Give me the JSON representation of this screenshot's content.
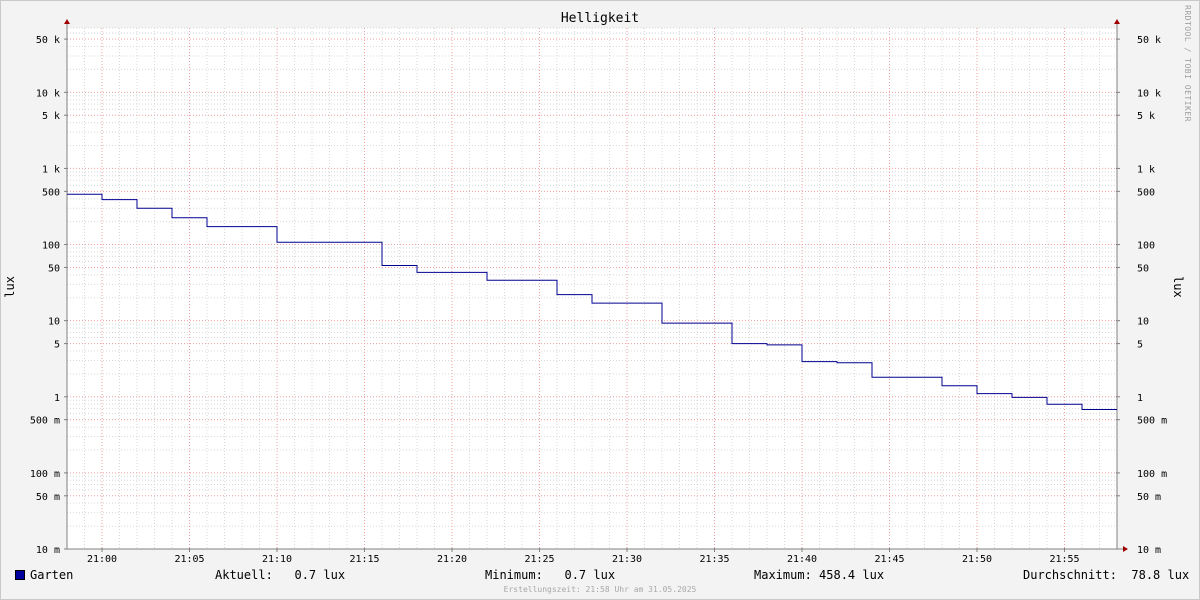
{
  "title": "Helligkeit",
  "vendor": "RRDTOOL / TOBI OETIKER",
  "ylabel": "lux",
  "colors": {
    "plot_bg": "#ffffff",
    "line": "#000090",
    "swatch": "#0000a0",
    "major_grid": "#f0a0a0",
    "minor_grid": "#d8d8d8",
    "axis": "#808080",
    "arrow": "#a00000"
  },
  "legend": {
    "series": "Garten",
    "current": "Aktuell:   0.7 lux",
    "minimum": "Minimum:   0.7 lux",
    "maximum": "Maximum: 458.4 lux",
    "average": "Durchschnitt:  78.8 lux"
  },
  "footer": "Erstellungszeit: 21:58 Uhr am 31.05.2025",
  "chart_data": {
    "type": "line",
    "title": "Helligkeit",
    "ylabel": "lux",
    "yscale": "log",
    "ylim": [
      0.01,
      70000
    ],
    "xlim": [
      "20:58",
      "21:58"
    ],
    "grid": true,
    "x_ticks": [
      "21:00",
      "21:05",
      "21:10",
      "21:15",
      "21:20",
      "21:25",
      "21:30",
      "21:35",
      "21:40",
      "21:45",
      "21:50",
      "21:55"
    ],
    "y_ticks": [
      {
        "value": 0.01,
        "label": "10 m"
      },
      {
        "value": 0.05,
        "label": "50 m"
      },
      {
        "value": 0.1,
        "label": "100 m"
      },
      {
        "value": 0.5,
        "label": "500 m"
      },
      {
        "value": 1,
        "label": "1"
      },
      {
        "value": 5,
        "label": "5"
      },
      {
        "value": 10,
        "label": "10"
      },
      {
        "value": 50,
        "label": "50"
      },
      {
        "value": 100,
        "label": "100"
      },
      {
        "value": 500,
        "label": "500"
      },
      {
        "value": 1000,
        "label": "1 k"
      },
      {
        "value": 5000,
        "label": "5 k"
      },
      {
        "value": 10000,
        "label": "10 k"
      },
      {
        "value": 50000,
        "label": "50 k"
      }
    ],
    "series": [
      {
        "name": "Garten",
        "step": true,
        "points": [
          {
            "x": "20:58",
            "y": 458.4
          },
          {
            "x": "21:00",
            "y": 390
          },
          {
            "x": "21:02",
            "y": 300
          },
          {
            "x": "21:04",
            "y": 225
          },
          {
            "x": "21:06",
            "y": 172
          },
          {
            "x": "21:10",
            "y": 107
          },
          {
            "x": "21:16",
            "y": 53
          },
          {
            "x": "21:18",
            "y": 43
          },
          {
            "x": "21:22",
            "y": 34
          },
          {
            "x": "21:26",
            "y": 22
          },
          {
            "x": "21:28",
            "y": 17
          },
          {
            "x": "21:32",
            "y": 9.3
          },
          {
            "x": "21:36",
            "y": 5
          },
          {
            "x": "21:38",
            "y": 4.8
          },
          {
            "x": "21:40",
            "y": 2.9
          },
          {
            "x": "21:42",
            "y": 2.8
          },
          {
            "x": "21:44",
            "y": 1.8
          },
          {
            "x": "21:48",
            "y": 1.4
          },
          {
            "x": "21:50",
            "y": 1.1
          },
          {
            "x": "21:52",
            "y": 0.98
          },
          {
            "x": "21:54",
            "y": 0.8
          },
          {
            "x": "21:56",
            "y": 0.68
          },
          {
            "x": "21:58",
            "y": 0.68
          }
        ]
      }
    ]
  }
}
